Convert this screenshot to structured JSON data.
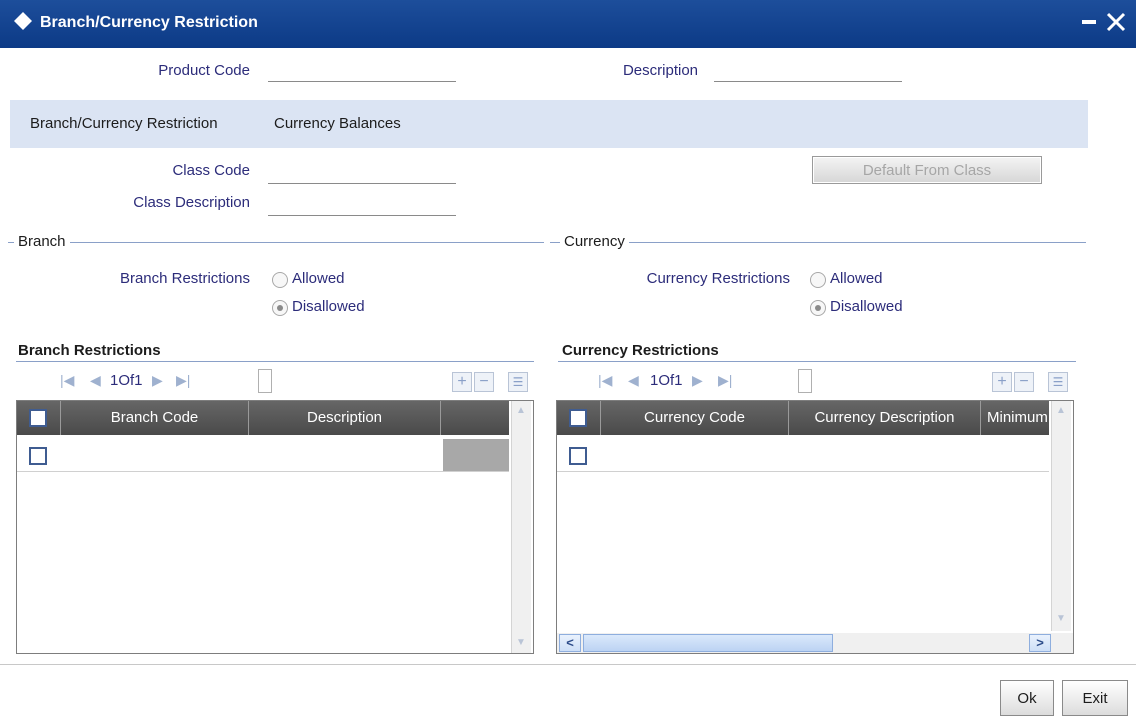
{
  "window": {
    "title": "Branch/Currency Restriction"
  },
  "header": {
    "product_code_label": "Product Code",
    "product_code_value": "",
    "description_label": "Description",
    "description_value": ""
  },
  "tabs": [
    {
      "label": "Branch/Currency Restriction",
      "active": true
    },
    {
      "label": "Currency Balances",
      "active": false
    }
  ],
  "class": {
    "code_label": "Class Code",
    "code_value": "",
    "description_label": "Class Description",
    "description_value": "",
    "default_button": "Default From Class"
  },
  "branch": {
    "legend": "Branch",
    "restrictions_label": "Branch Restrictions",
    "options": [
      "Allowed",
      "Disallowed"
    ],
    "selected": "Disallowed"
  },
  "currency": {
    "legend": "Currency",
    "restrictions_label": "Currency Restrictions",
    "options": [
      "Allowed",
      "Disallowed"
    ],
    "selected": "Disallowed"
  },
  "branch_grid": {
    "title": "Branch Restrictions",
    "pagination": "1Of1",
    "columns": [
      "Branch Code",
      "Description"
    ],
    "rows": [
      {
        "branch_code": "",
        "description": ""
      }
    ]
  },
  "currency_grid": {
    "title": "Currency Restrictions",
    "pagination": "1Of1",
    "columns": [
      "Currency Code",
      "Currency Description",
      "Minimum"
    ],
    "rows": [
      {
        "currency_code": "",
        "currency_description": "",
        "minimum": ""
      }
    ]
  },
  "footer": {
    "ok": "Ok",
    "exit": "Exit"
  },
  "colors": {
    "titlebar": "#0c3a86",
    "tabbar": "#dbe4f3",
    "label": "#2c2c7a",
    "grid_header": "#555555"
  }
}
